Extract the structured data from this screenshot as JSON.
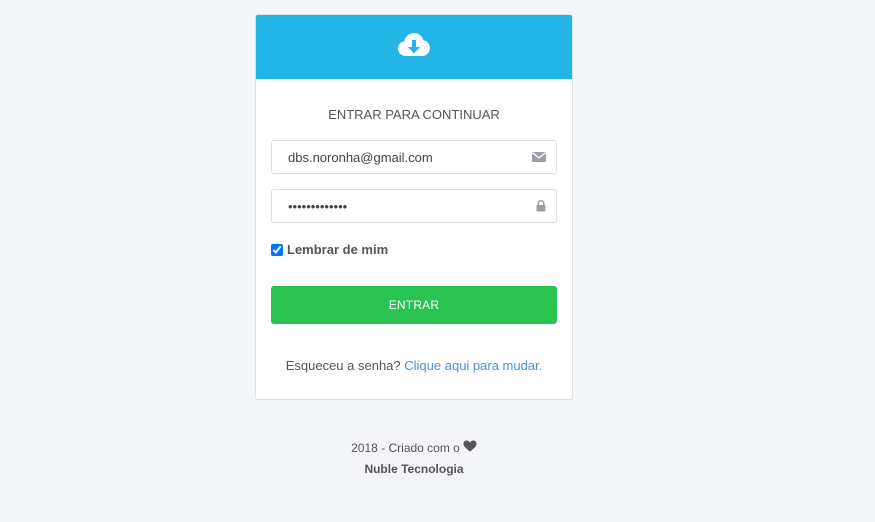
{
  "header": {
    "icon": "cloud-download-icon",
    "color": "#22b5e5"
  },
  "login": {
    "title": "ENTRAR PARA CONTINUAR",
    "email": {
      "value": "dbs.noronha@gmail.com",
      "icon": "envelope-icon"
    },
    "password": {
      "value": "•••••••••••••",
      "icon": "lock-icon"
    },
    "remember": {
      "label": "Lembrar de mim",
      "checked": true
    },
    "submit_label": "ENTRAR",
    "submit_color": "#28c350",
    "forgot": {
      "text": "Esqueceu a senha?",
      "link": "Clique aqui para mudar."
    }
  },
  "footer": {
    "line1": "2018 - Criado com o",
    "heart_icon": "heart-icon",
    "company": "Nuble Tecnologia"
  }
}
